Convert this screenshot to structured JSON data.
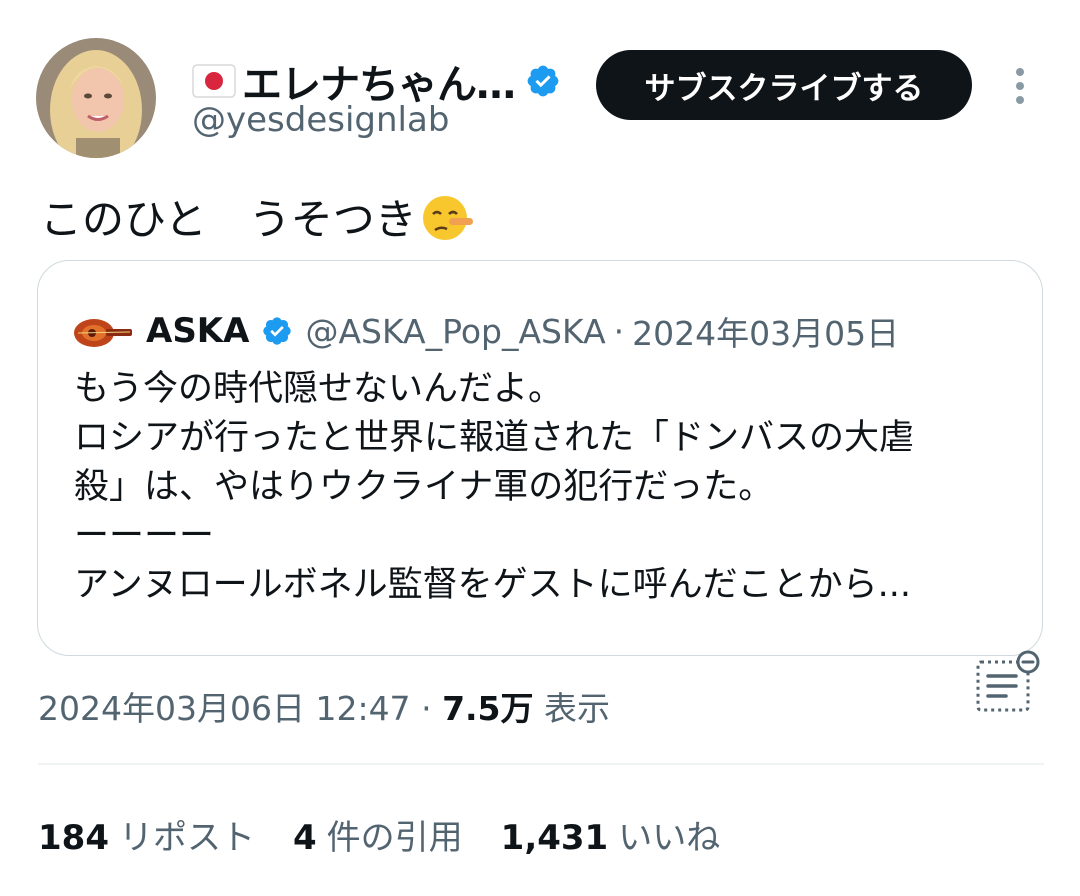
{
  "author": {
    "display_name": "エレナちゃん…",
    "handle": "@yesdesignlab",
    "flag_icon": "japan-flag-icon"
  },
  "subscribe_label": "サブスクライブする",
  "tweet_text": "このひと　うそつき",
  "tweet_emoji": "lying-face-emoji",
  "quote": {
    "name": "ASKA",
    "handle": "@ASKA_Pop_ASKA",
    "separator": "·",
    "date": "2024年03月05日",
    "lines": [
      "もう今の時代隠せないんだよ。",
      "ロシアが行ったと世界に報道された「ドンバスの大虐",
      "殺」は、やはりウクライナ軍の犯行だった。",
      "ーーーー",
      "アンヌロールボネル監督をゲストに呼んだことから..."
    ]
  },
  "meta": {
    "timestamp": "2024年03月06日 12:47",
    "separator": "·",
    "views": "7.5万",
    "views_label": "表示"
  },
  "stats": {
    "reposts": "184",
    "reposts_label": "リポスト",
    "quotes": "4",
    "quotes_label": "件の引用",
    "likes": "1,431",
    "likes_label": "いいね"
  },
  "colors": {
    "verified": "#1d9bf0",
    "text": "#0f1419",
    "secondary": "#536471",
    "border": "#cfd9de"
  }
}
